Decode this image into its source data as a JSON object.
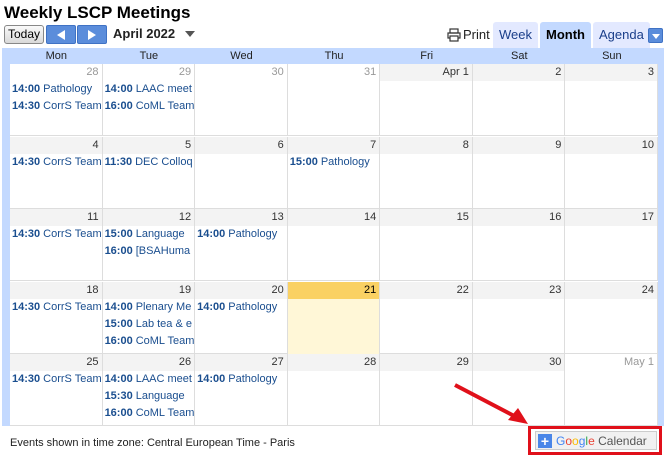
{
  "title": "Weekly LSCP Meetings",
  "toolbar": {
    "today_label": "Today",
    "month_label": "April 2022",
    "print_label": "Print",
    "tabs": [
      "Week",
      "Month",
      "Agenda"
    ]
  },
  "days_of_week": [
    "Mon",
    "Tue",
    "Wed",
    "Thu",
    "Fri",
    "Sat",
    "Sun"
  ],
  "weeks": [
    {
      "days": [
        {
          "num": "28",
          "other": true,
          "events": [
            [
              "14:00",
              "Pathology"
            ],
            [
              "14:30",
              "CorrS Team"
            ]
          ]
        },
        {
          "num": "29",
          "other": true,
          "events": [
            [
              "14:00",
              "LAAC meet"
            ],
            [
              "16:00",
              "CoML Team"
            ]
          ]
        },
        {
          "num": "30",
          "other": true,
          "events": []
        },
        {
          "num": "31",
          "other": true,
          "events": []
        },
        {
          "num": "Apr 1",
          "other": false,
          "events": []
        },
        {
          "num": "2",
          "other": false,
          "events": []
        },
        {
          "num": "3",
          "other": false,
          "events": []
        }
      ]
    },
    {
      "days": [
        {
          "num": "4",
          "events": [
            [
              "14:30",
              "CorrS Team"
            ]
          ]
        },
        {
          "num": "5",
          "events": [
            [
              "11:30",
              "DEC Colloq"
            ]
          ]
        },
        {
          "num": "6",
          "events": []
        },
        {
          "num": "7",
          "events": [
            [
              "15:00",
              "Pathology"
            ]
          ]
        },
        {
          "num": "8",
          "events": []
        },
        {
          "num": "9",
          "events": []
        },
        {
          "num": "10",
          "events": []
        }
      ]
    },
    {
      "days": [
        {
          "num": "11",
          "events": [
            [
              "14:30",
              "CorrS Team"
            ]
          ]
        },
        {
          "num": "12",
          "events": [
            [
              "15:00",
              "Language"
            ],
            [
              "16:00",
              "[BSAHuma"
            ]
          ]
        },
        {
          "num": "13",
          "events": [
            [
              "14:00",
              "Pathology"
            ]
          ]
        },
        {
          "num": "14",
          "events": []
        },
        {
          "num": "15",
          "events": []
        },
        {
          "num": "16",
          "events": []
        },
        {
          "num": "17",
          "events": []
        }
      ]
    },
    {
      "days": [
        {
          "num": "18",
          "events": [
            [
              "14:30",
              "CorrS Team"
            ]
          ]
        },
        {
          "num": "19",
          "events": [
            [
              "14:00",
              "Plenary Me"
            ],
            [
              "15:00",
              "Lab tea & e"
            ],
            [
              "16:00",
              "CoML Team"
            ]
          ]
        },
        {
          "num": "20",
          "events": [
            [
              "14:00",
              "Pathology"
            ]
          ]
        },
        {
          "num": "21",
          "today": true,
          "events": []
        },
        {
          "num": "22",
          "events": []
        },
        {
          "num": "23",
          "events": []
        },
        {
          "num": "24",
          "events": []
        }
      ]
    },
    {
      "days": [
        {
          "num": "25",
          "events": [
            [
              "14:30",
              "CorrS Team"
            ]
          ]
        },
        {
          "num": "26",
          "events": [
            [
              "14:00",
              "LAAC meet"
            ],
            [
              "15:30",
              "Language"
            ],
            [
              "16:00",
              "CoML Team"
            ]
          ]
        },
        {
          "num": "27",
          "events": [
            [
              "14:00",
              "Pathology"
            ]
          ]
        },
        {
          "num": "28",
          "events": []
        },
        {
          "num": "29",
          "events": []
        },
        {
          "num": "30",
          "events": []
        },
        {
          "num": "May 1",
          "other": true,
          "events": []
        }
      ]
    }
  ],
  "footer": {
    "timezone_text": "Events shown in time zone: Central European Time - Paris",
    "gcal": {
      "plus": "+",
      "google": [
        "G",
        "o",
        "o",
        "g",
        "l",
        "e"
      ],
      "calendar": "Calendar"
    }
  }
}
